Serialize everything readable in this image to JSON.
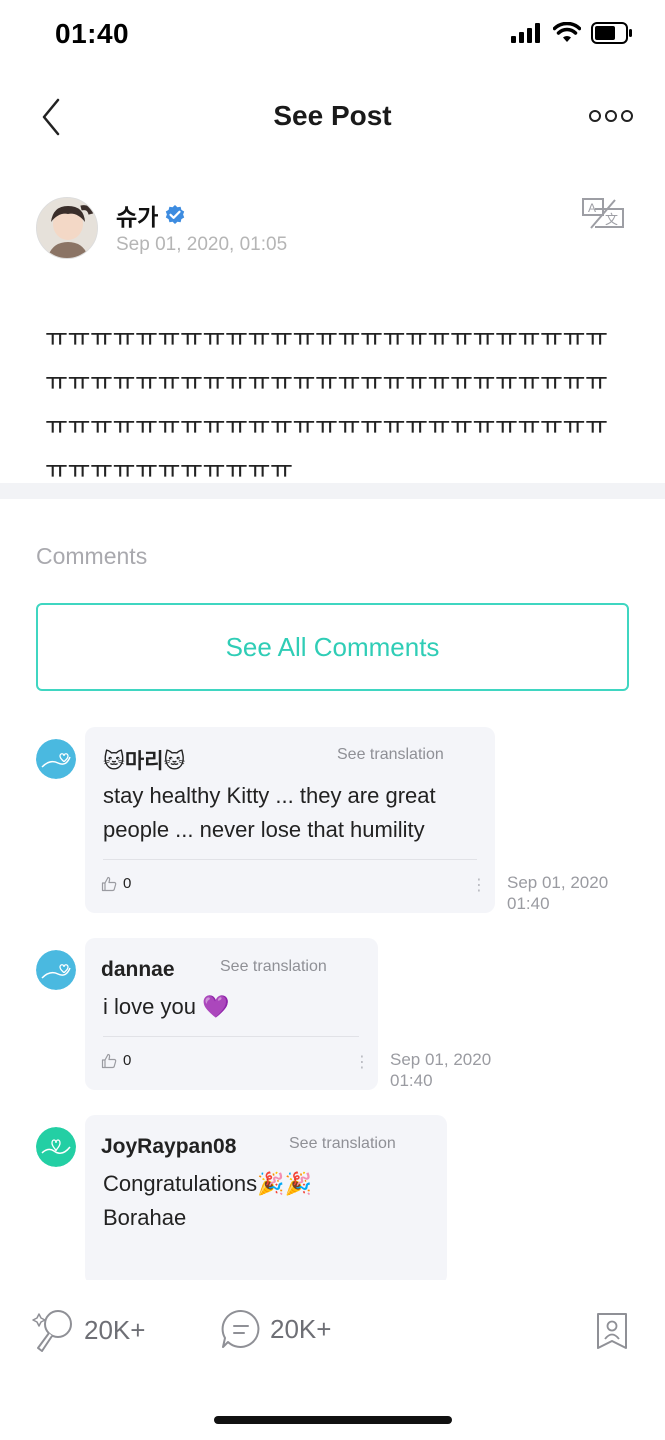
{
  "status_bar": {
    "time": "01:40"
  },
  "header": {
    "title": "See Post"
  },
  "author": {
    "name": "슈가",
    "date": "Sep 01, 2020, 01:05",
    "verified": true
  },
  "post": {
    "text": "ㅠㅠㅠㅠㅠㅠㅠㅠㅠㅠㅠㅠㅠㅠㅠㅠㅠㅠㅠㅠㅠㅠㅠㅠㅠㅠㅠㅠㅠㅠㅠㅠㅠㅠㅠㅠㅠㅠㅠㅠㅠㅠㅠㅠㅠㅠㅠㅠㅠㅠㅠㅠㅠㅠㅠㅠㅠㅠㅠㅠㅠㅠㅠㅠㅠㅠㅠㅠㅠㅠㅠㅠㅠㅠㅠㅠㅠㅠㅠㅠㅠㅠㅠㅠㅠㅠ"
  },
  "comments_section": {
    "heading": "Comments",
    "see_all_label": "See All Comments",
    "items": [
      {
        "name": "🐱마리🐱",
        "see_translation": "See translation",
        "text": "stay healthy Kitty ... they are great people ... never lose that humility",
        "likes": "0",
        "date_line1": "Sep 01, 2020",
        "date_line2": "01:40"
      },
      {
        "name": "dannae",
        "see_translation": "See translation",
        "text": "i love you 💜",
        "likes": "0",
        "date_line1": "Sep 01, 2020",
        "date_line2": "01:40"
      },
      {
        "name": "JoyRaypan08",
        "see_translation": "See translation",
        "text_line1": "Congratulations🎉🎉",
        "text_line2": "Borahae"
      }
    ]
  },
  "bottom_bar": {
    "likes_count": "20K+",
    "comments_count": "20K+"
  },
  "colors": {
    "accent": "#2fcdb6",
    "bubble": "#f4f5f9",
    "muted": "#a9a9ae",
    "verified": "#3d8ce0"
  }
}
